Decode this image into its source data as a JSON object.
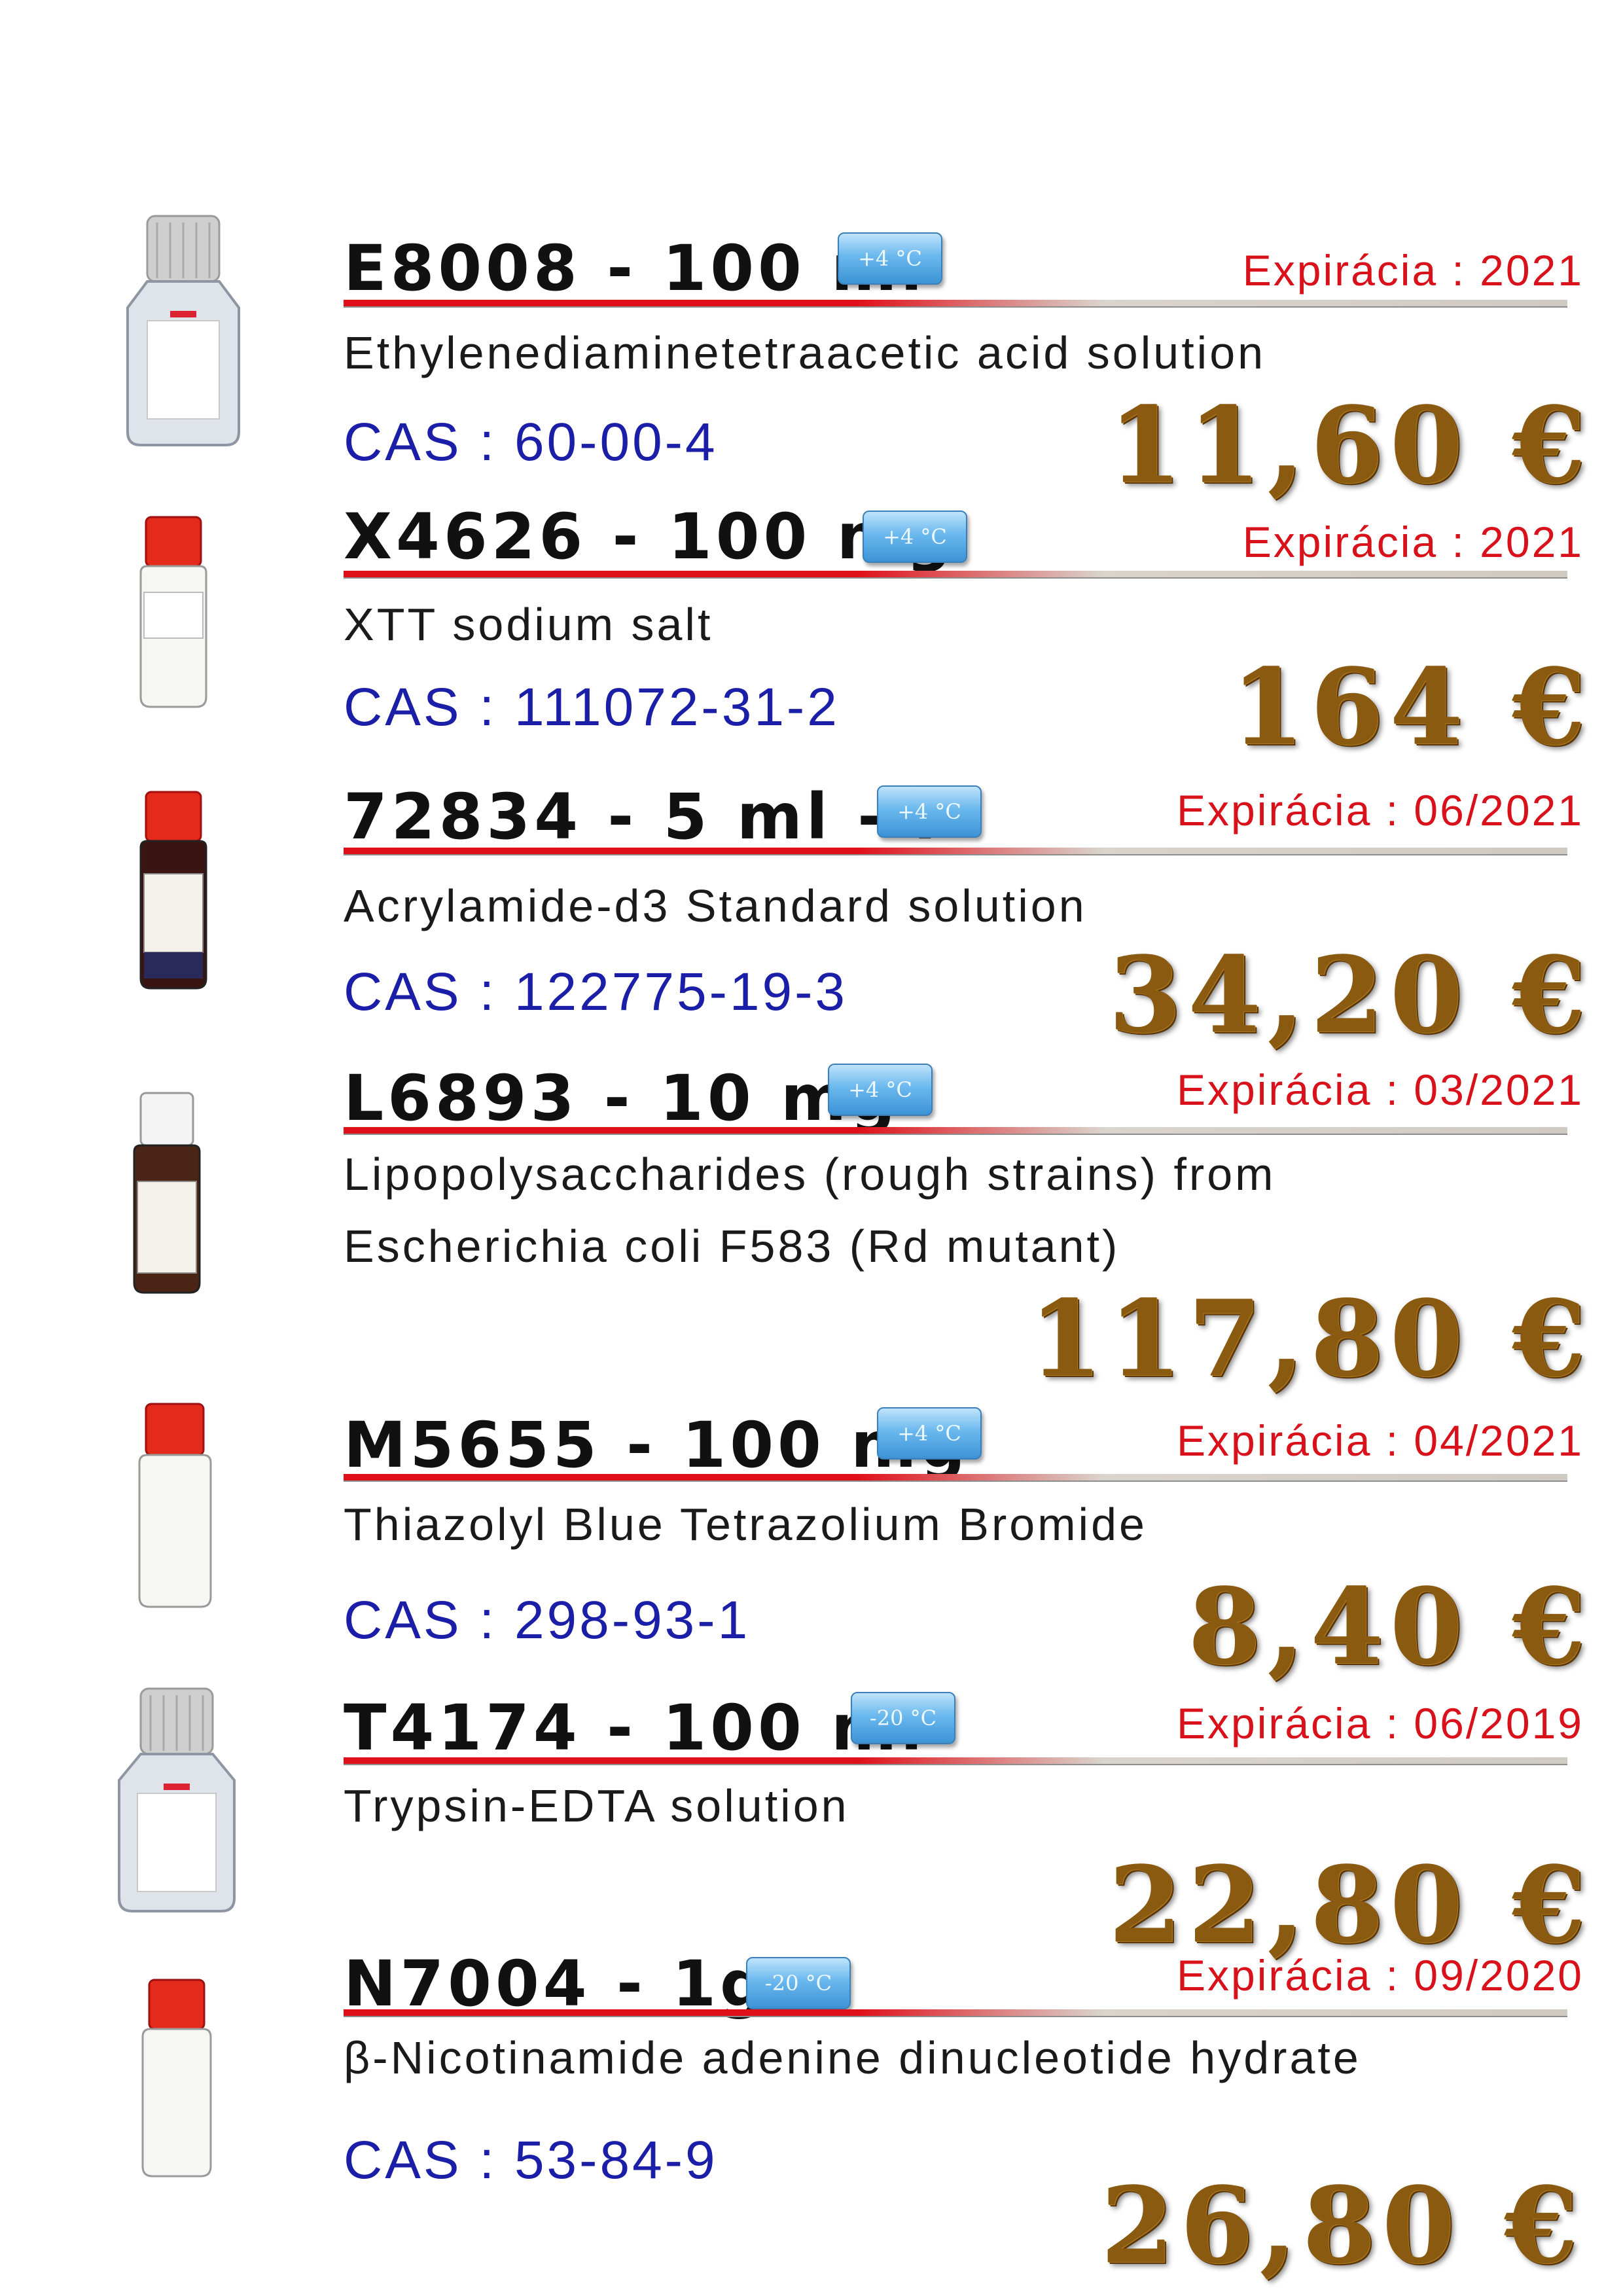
{
  "products": [
    {
      "code": "E8008 - 100 ml",
      "temp": "+4 °C",
      "expiry": "Expirácia : 2021",
      "name_lines": [
        "Ethylenediaminetetraacetic acid solution"
      ],
      "cas": "CAS : 60-00-4",
      "price": "11,60 €",
      "bottle": "plastic-bottle-icon"
    },
    {
      "code": "X4626 - 100 mg",
      "temp": "+4 °C",
      "expiry": "Expirácia : 2021",
      "name_lines": [
        "XTT sodium salt"
      ],
      "cas": "CAS : 111072-31-2",
      "price": "164 €",
      "bottle": "white-vial-icon"
    },
    {
      "code": "72834 - 5 ml - F",
      "temp": "+4 °C",
      "expiry": "Expirácia : 06/2021",
      "name_lines": [
        "Acrylamide-d3 Standard solution"
      ],
      "cas": "CAS : 122775-19-3",
      "price": "34,20 €",
      "bottle": "amber-vial-icon"
    },
    {
      "code": "L6893 - 10 mg",
      "temp": "+4 °C",
      "expiry": "Expirácia : 03/2021",
      "name_lines": [
        "Lipopolysaccharides (rough strains) from",
        "Escherichia coli F583 (Rd mutant)"
      ],
      "cas": "",
      "price": "117,80 €",
      "bottle": "brown-vial-icon"
    },
    {
      "code": "M5655 - 100 mg",
      "temp": "+4 °C",
      "expiry": "Expirácia : 04/2021",
      "name_lines": [
        "Thiazolyl Blue Tetrazolium Bromide"
      ],
      "cas": "CAS : 298-93-1",
      "price": "8,40 €",
      "bottle": "white-vial-icon"
    },
    {
      "code": "T4174 - 100 ml",
      "temp": "-20 °C",
      "expiry": "Expirácia : 06/2019",
      "name_lines": [
        "Trypsin-EDTA solution"
      ],
      "cas": "",
      "price": "22,80 €",
      "bottle": "plastic-bottle-icon"
    },
    {
      "code": "N7004 - 1g",
      "temp": "-20 °C",
      "expiry": "Expirácia : 09/2020",
      "name_lines": [
        "β-Nicotinamide adenine dinucleotide hydrate"
      ],
      "cas": "CAS : 53-84-9",
      "price": "26,80 €",
      "bottle": "white-vial-icon"
    }
  ],
  "colors": {
    "expiry": "#d8111a",
    "cas": "#1b1ea6",
    "price_gold": "#8a5a10",
    "rule_red": "#e0101a",
    "temp_badge": "#5aaee8"
  }
}
